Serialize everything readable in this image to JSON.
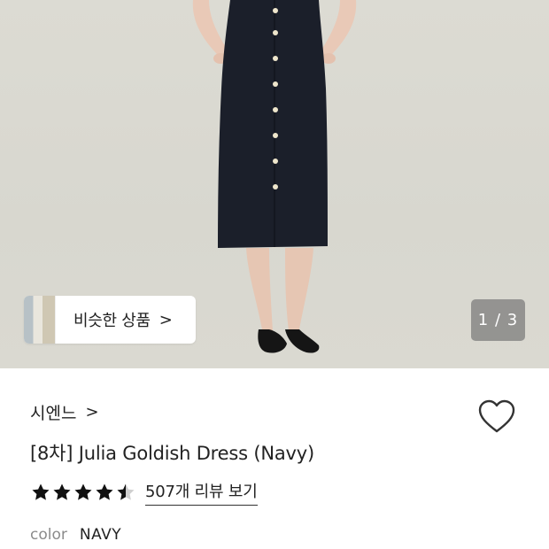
{
  "hero": {
    "similar_products_label": "비슷한 상품",
    "similar_products_chevron": ">",
    "image_counter": "1 / 3"
  },
  "product": {
    "brand": "시엔느",
    "brand_chevron": ">",
    "title": "[8차] Julia Goldish Dress (Navy)",
    "rating": 4.5,
    "review_link": "507개 리뷰 보기",
    "color_label": "color",
    "color_value": "NAVY"
  },
  "colors": {
    "dress": "#1b1f2a",
    "background": "#dcdbd3",
    "star": "#111111"
  }
}
